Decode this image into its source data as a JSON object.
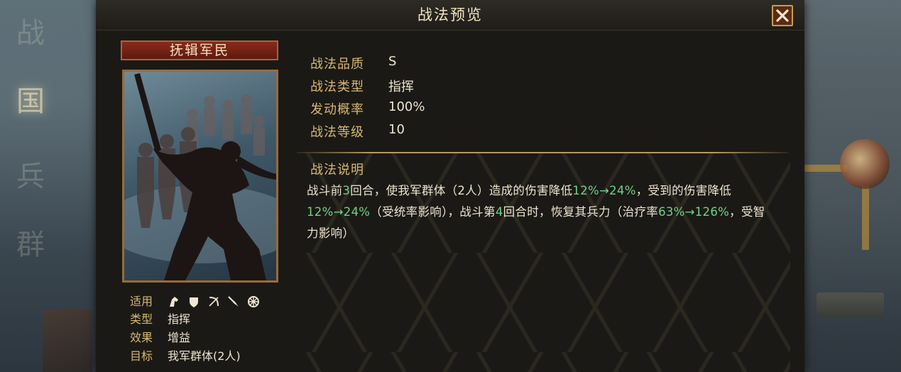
{
  "window": {
    "title": "战法预览"
  },
  "skill": {
    "name": "抚辑军民",
    "quality_label": "战法品质",
    "quality": "S",
    "type_label": "战法类型",
    "type": "指挥",
    "chance_label": "发动概率",
    "chance": "100%",
    "level_label": "战法等级",
    "level": "10"
  },
  "card_info": {
    "applicable_label": "适用",
    "applicable_icons": [
      "cavalry-icon",
      "shield-icon",
      "bow-icon",
      "spear-icon",
      "wheel-icon"
    ],
    "type_label": "类型",
    "type": "指挥",
    "effect_label": "效果",
    "effect": "增益",
    "target_label": "目标",
    "target": "我军群体(2人)"
  },
  "description": {
    "title": "战法说明",
    "segments": [
      {
        "text": "战斗前",
        "hl": false
      },
      {
        "text": "3",
        "hl": true
      },
      {
        "text": "回合，使我军群体（2人）造成的伤害降低",
        "hl": false
      },
      {
        "text": "12%→24%",
        "hl": true
      },
      {
        "text": "，受到的伤害降低",
        "hl": false
      },
      {
        "text": "12%→24%",
        "hl": true
      },
      {
        "text": "（受统率影响），战斗第",
        "hl": false
      },
      {
        "text": "4",
        "hl": true
      },
      {
        "text": "回合时，恢复其兵力（治疗率",
        "hl": false
      },
      {
        "text": "63%→126%",
        "hl": true
      },
      {
        "text": "，受智力影响）",
        "hl": false
      }
    ]
  },
  "background": {
    "left_glyphs": [
      "战",
      "国",
      "兵",
      "群"
    ]
  },
  "colors": {
    "accent_gold": "#d5b873",
    "highlight_green": "#6ed28a",
    "name_plate_red": "#8a2a1a"
  }
}
